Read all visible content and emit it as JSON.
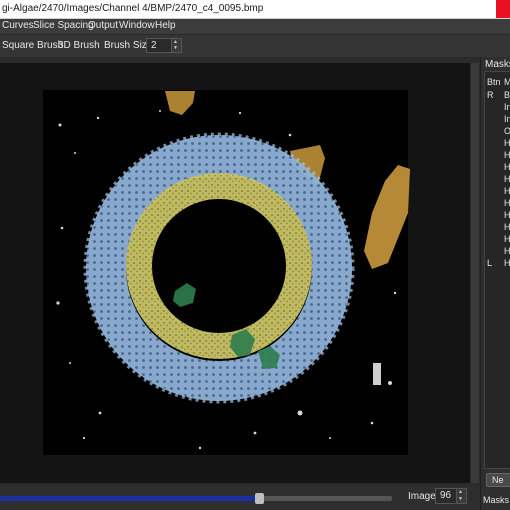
{
  "window": {
    "title": "gi-Algae/2470/Images/Channel 4/BMP/2470_c4_0095.bmp"
  },
  "menu": [
    "Curves",
    "Slice Spacing",
    "Output",
    "Window",
    "Help"
  ],
  "toolbar": {
    "square_brush": "Square Brush",
    "brush_3d": "3D Brush",
    "brush_size_label": "Brush Size:",
    "brush_size_value": "2"
  },
  "bottom": {
    "image_label": "Image:",
    "image_value": "96",
    "slider_fraction": 0.66
  },
  "masks_panel": {
    "title": "Masks (",
    "col_btn": "Btn",
    "col_mask": "M",
    "rows": [
      {
        "btn": "R",
        "name": "Ba"
      },
      {
        "btn": "",
        "name": "In"
      },
      {
        "btn": "",
        "name": "In"
      },
      {
        "btn": "",
        "name": "Ou"
      },
      {
        "btn": "",
        "name": "Hy"
      },
      {
        "btn": "",
        "name": "Hy"
      },
      {
        "btn": "",
        "name": "Hy"
      },
      {
        "btn": "",
        "name": "Hy"
      },
      {
        "btn": "",
        "name": "Hy"
      },
      {
        "btn": "",
        "name": "Hy"
      },
      {
        "btn": "",
        "name": "Hy"
      },
      {
        "btn": "",
        "name": "Hy"
      },
      {
        "btn": "",
        "name": "Hy"
      },
      {
        "btn": "",
        "name": "Hy"
      },
      {
        "btn": "L",
        "name": "Hy"
      }
    ],
    "new_button": "Ne",
    "bottom_label": "Masks (..."
  },
  "colors": {
    "outer_ring": "#8fb2d8",
    "inner_ring": "#c9c466",
    "green_mask": "#2e7d4f",
    "orange_mask": "#c9983b",
    "slider_fill": "#1d2f9e"
  }
}
